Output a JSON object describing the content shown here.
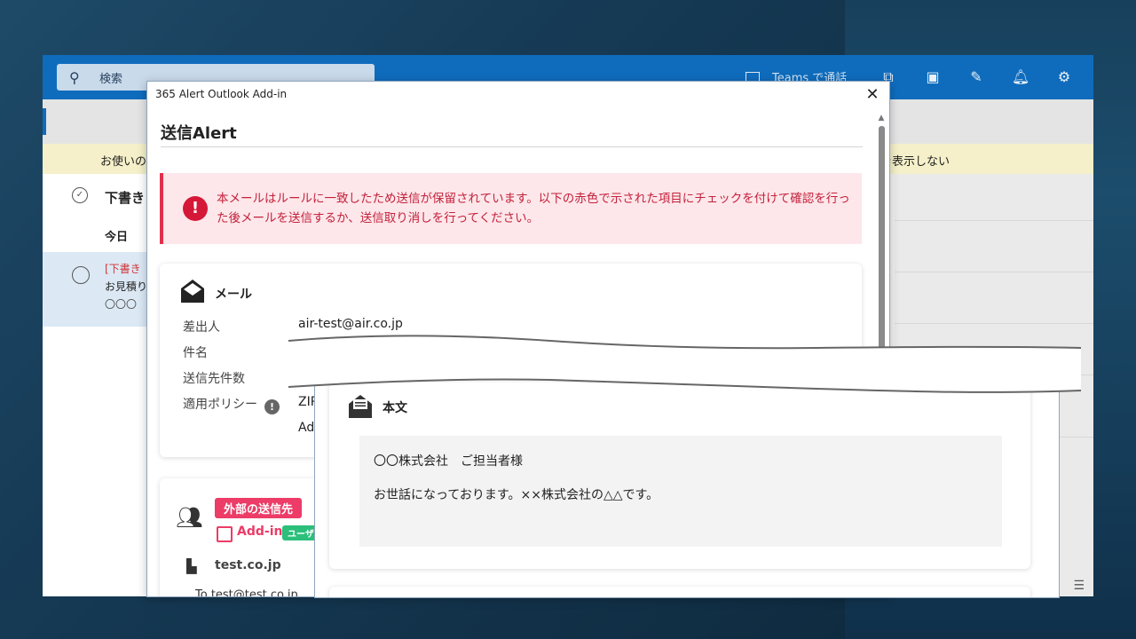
{
  "outlook": {
    "search_placeholder": "検索",
    "teams_label": "Teams で通話",
    "banner_left": "お使いの",
    "banner_right": "を表示しない",
    "folder_title": "下書き",
    "group_today": "今日",
    "item": {
      "line1": "[下書き",
      "line2": "お見積り",
      "line3": "〇〇〇"
    }
  },
  "dialog": {
    "title": "365 Alert Outlook Add-in",
    "close_label": "✕",
    "heading": "送信Alert",
    "alert_text": "本メールはルールに一致したため送信が保留されています。以下の赤色で示された項目にチェックを付けて確認を行った後メールを送信するか、送信取り消しを行ってください。",
    "mail_card": {
      "title": "メール",
      "rows": [
        {
          "label": "差出人",
          "value": "air-test@air.co.jp"
        },
        {
          "label": "件名",
          "value": ""
        },
        {
          "label": "送信先件数",
          "value": ""
        },
        {
          "label": "適用ポリシー",
          "value": "ZIP"
        }
      ],
      "policy_extra": "Ad"
    },
    "recipient_card": {
      "tag_external": "外部の送信先",
      "addin_label": "Add-in",
      "tag_user": "ユーザ",
      "domain": "test.co.jp",
      "to_line": "To   test@test.co.jp"
    }
  },
  "body_panel": {
    "title": "本文",
    "line1": "〇〇株式会社　ご担当者様",
    "line2": "お世話になっております。××株式会社の△△です。"
  }
}
